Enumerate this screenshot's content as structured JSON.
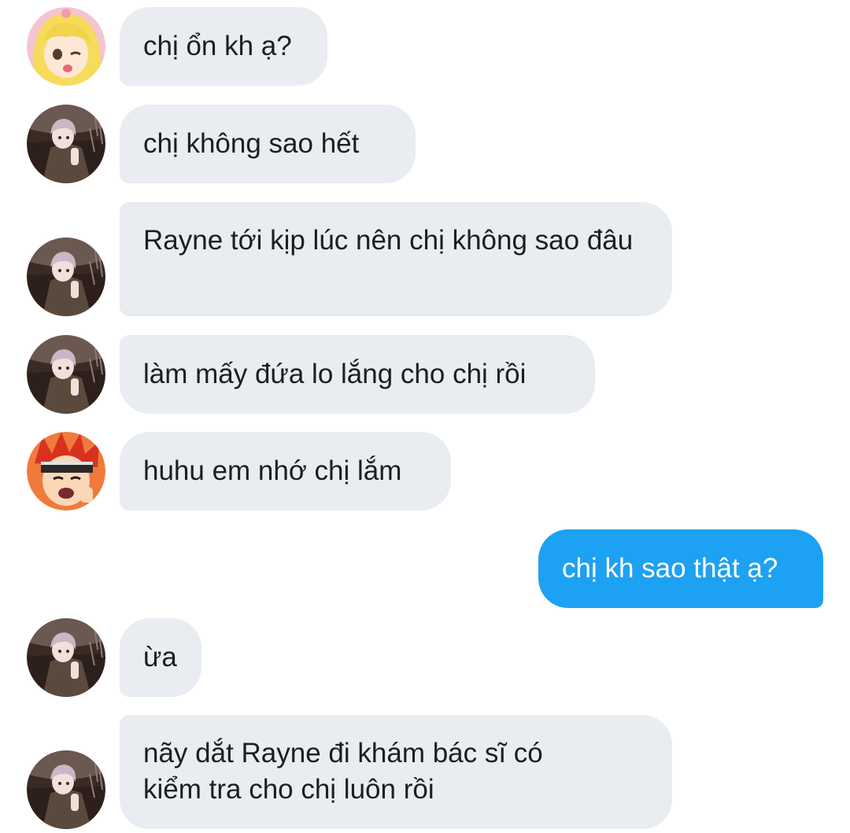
{
  "messages": [
    {
      "sender": "blonde-girl",
      "text": "chị ổn kh ạ?"
    },
    {
      "sender": "silver-hair",
      "text": "chị không sao hết"
    },
    {
      "sender": "silver-hair",
      "text": "Rayne tới kịp lúc nên chị không sao đâu"
    },
    {
      "sender": "silver-hair",
      "text": "làm mấy đứa lo lắng cho chị rồi"
    },
    {
      "sender": "red-hair",
      "text": "huhu em nhớ chị lắm"
    },
    {
      "sender": "me",
      "text": "chị kh sao thật ạ?"
    },
    {
      "sender": "silver-hair",
      "text": "ừa"
    },
    {
      "sender": "silver-hair",
      "text": "nãy dắt Rayne đi khám bác sĩ có kiểm tra cho chị luôn rồi"
    }
  ],
  "colors": {
    "incoming_bubble": "#e9ecf0",
    "outgoing_bubble": "#1da1f2",
    "incoming_text": "#1c1e21",
    "outgoing_text": "#ffffff"
  },
  "icons": {
    "blonde-girl": "avatar-blonde-girl-icon",
    "silver-hair": "avatar-silver-hair-icon",
    "red-hair": "avatar-red-hair-icon"
  }
}
